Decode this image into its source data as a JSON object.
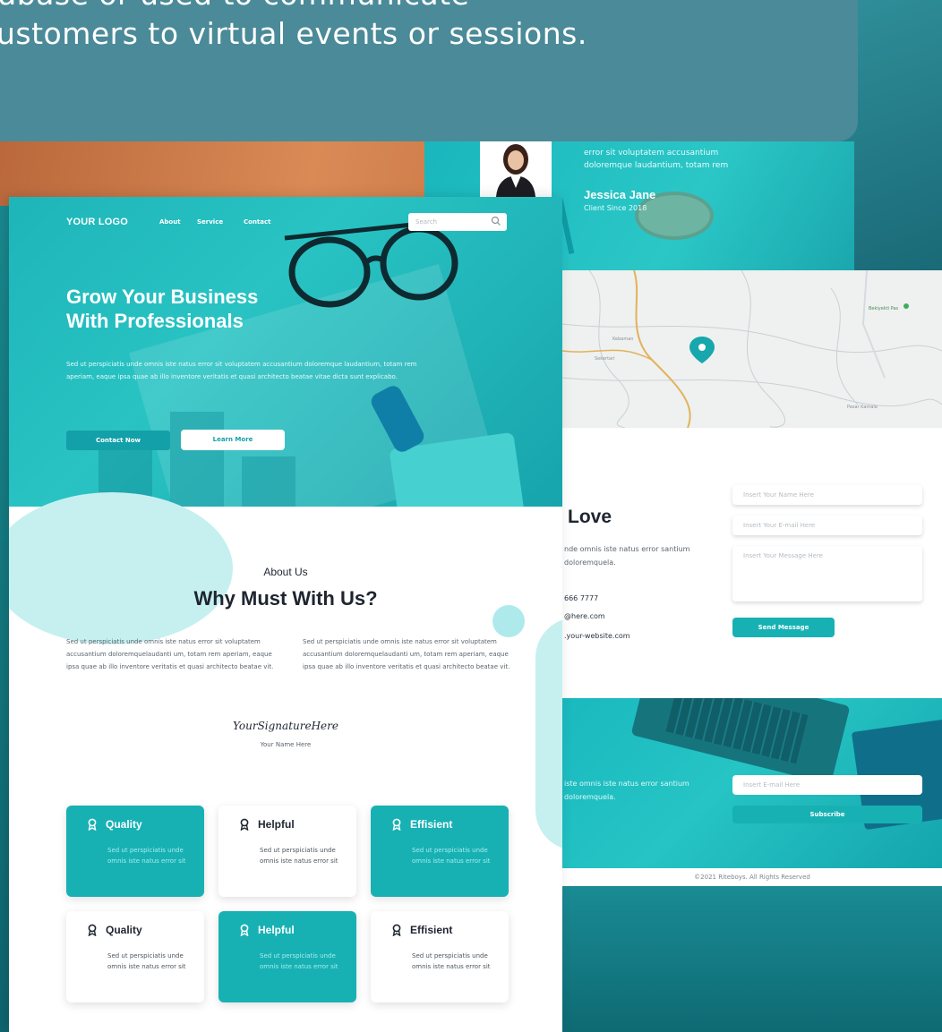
{
  "caption": {
    "line1": "abase or used to communicate",
    "line2": "ustomers to virtual events or sessions."
  },
  "testimonial": {
    "text": "error sit voluptatem accusantium doloremque laudantium, totam rem",
    "name": "Jessica Jane",
    "since": "Client Since 2018"
  },
  "map": {
    "label_1": "Kebaman",
    "label_2": "Sekertari",
    "label_3": "Pasar Kamala",
    "label_4": "Bekiyekti Pas"
  },
  "contact": {
    "title": "Love",
    "description": "nde omnis iste natus error santium doloremquela.",
    "phone": "666 7777",
    "email": "@here.com",
    "website": ".your-website.com",
    "name_placeholder": "Insert Your Name Here",
    "email_placeholder": "Insert Your E-mail Here",
    "message_placeholder": "Insert Your Message Here",
    "send_label": "Send Message"
  },
  "newsletter": {
    "text": "iste omnis iste natus error santium doloremquela.",
    "email_placeholder": "Insert E-mail Here",
    "subscribe_label": "Subscribe"
  },
  "footer": {
    "copyright": "©2021 Riteboys. All Rights Reserved"
  },
  "header": {
    "logo": "YOUR LOGO",
    "nav": [
      "About",
      "Service",
      "Contact"
    ],
    "search_placeholder": "Search"
  },
  "hero": {
    "title_line1": "Grow Your Business",
    "title_line2": "With Professionals",
    "description": "Sed ut perspiciatis unde omnis iste natus error sit voluptatem accusantium doloremque laudantium, totam rem aperiam, eaque ipsa quae ab illo inventore veritatis et quasi architecto beatae vitae dicta sunt explicabo.",
    "contact_button": "Contact Now",
    "learn_button": "Learn More"
  },
  "about": {
    "label": "About Us",
    "title": "Why Must With Us?",
    "col1": "Sed ut perspiciatis unde omnis iste natus error sit voluptatem accusantium doloremquelaudanti um, totam rem aperiam, eaque ipsa quae ab illo inventore veritatis et quasi architecto beatae vit.",
    "col2": "Sed ut perspiciatis unde omnis iste natus error sit voluptatem accusantium doloremquelaudanti um, totam rem aperiam, eaque ipsa quae ab illo inventore veritatis et quasi architecto beatae vit.",
    "signature": "YourSignatureHere",
    "signature_name": "Your Name Here"
  },
  "cards": [
    {
      "title": "Quality",
      "body": "Sed ut perspiciatis unde omnis iste natus error sit",
      "style": "teal"
    },
    {
      "title": "Helpful",
      "body": "Sed ut perspiciatis unde omnis iste natus error sit",
      "style": "white"
    },
    {
      "title": "Effisient",
      "body": "Sed ut perspiciatis unde omnis iste natus error sit",
      "style": "teal"
    },
    {
      "title": "Quality",
      "body": "Sed ut perspiciatis unde omnis iste natus error sit",
      "style": "white"
    },
    {
      "title": "Helpful",
      "body": "Sed ut perspiciatis unde omnis iste natus error sit",
      "style": "teal"
    },
    {
      "title": "Effisient",
      "body": "Sed ut perspiciatis unde omnis iste natus error sit",
      "style": "white"
    }
  ],
  "colors": {
    "accent": "#17b1b4",
    "caption_bg": "#4b8a98",
    "heading": "#1e2530",
    "orange_bg": "#d98a55"
  },
  "icons": [
    "search-icon",
    "map-pin-icon",
    "award-icon"
  ]
}
